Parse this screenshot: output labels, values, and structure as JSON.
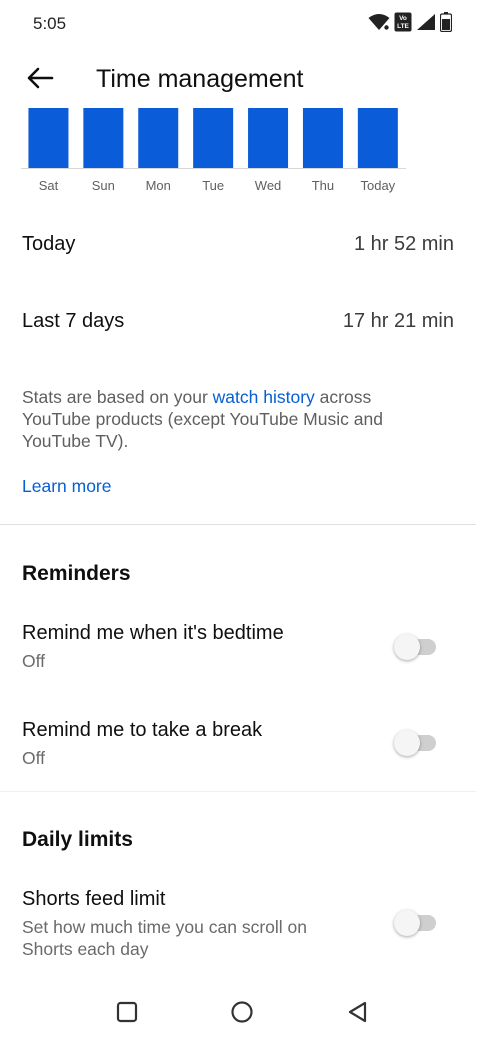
{
  "status_bar": {
    "time": "5:05",
    "icons": [
      "wifi-icon",
      "volte-icon",
      "signal-icon",
      "battery-icon"
    ],
    "volte_label_1": "Vo",
    "volte_label_2": "LTE"
  },
  "header": {
    "title": "Time management",
    "back_icon": "arrow-back-icon"
  },
  "chart_data": {
    "type": "bar",
    "categories": [
      "Sat",
      "Sun",
      "Mon",
      "Tue",
      "Wed",
      "Thu",
      "Today"
    ],
    "values": [
      1,
      1,
      1,
      1,
      1,
      1,
      1
    ],
    "bar_color": "#0b5cd8",
    "baseline_color": "#d8d8d8"
  },
  "stats": {
    "today_label": "Today",
    "today_value": "1 hr 52 min",
    "week_label": "Last 7 days",
    "week_value": "17 hr 21 min"
  },
  "info": {
    "text_before": "Stats are based on your ",
    "link_text": "watch history",
    "text_after": " across YouTube products (except YouTube Music and YouTube TV).",
    "learn_more": "Learn more",
    "link_color": "#065fd4"
  },
  "reminders": {
    "title": "Reminders",
    "items": [
      {
        "title": "Remind me when it's bedtime",
        "status": "Off",
        "enabled": false
      },
      {
        "title": "Remind me to take a break",
        "status": "Off",
        "enabled": false
      }
    ]
  },
  "daily_limits": {
    "title": "Daily limits",
    "items": [
      {
        "title": "Shorts feed limit",
        "description": "Set how much time you can scroll on Shorts each day",
        "enabled": false
      }
    ]
  },
  "nav_bar": {
    "icons": [
      "recents-square-icon",
      "home-circle-icon",
      "back-triangle-icon"
    ]
  }
}
